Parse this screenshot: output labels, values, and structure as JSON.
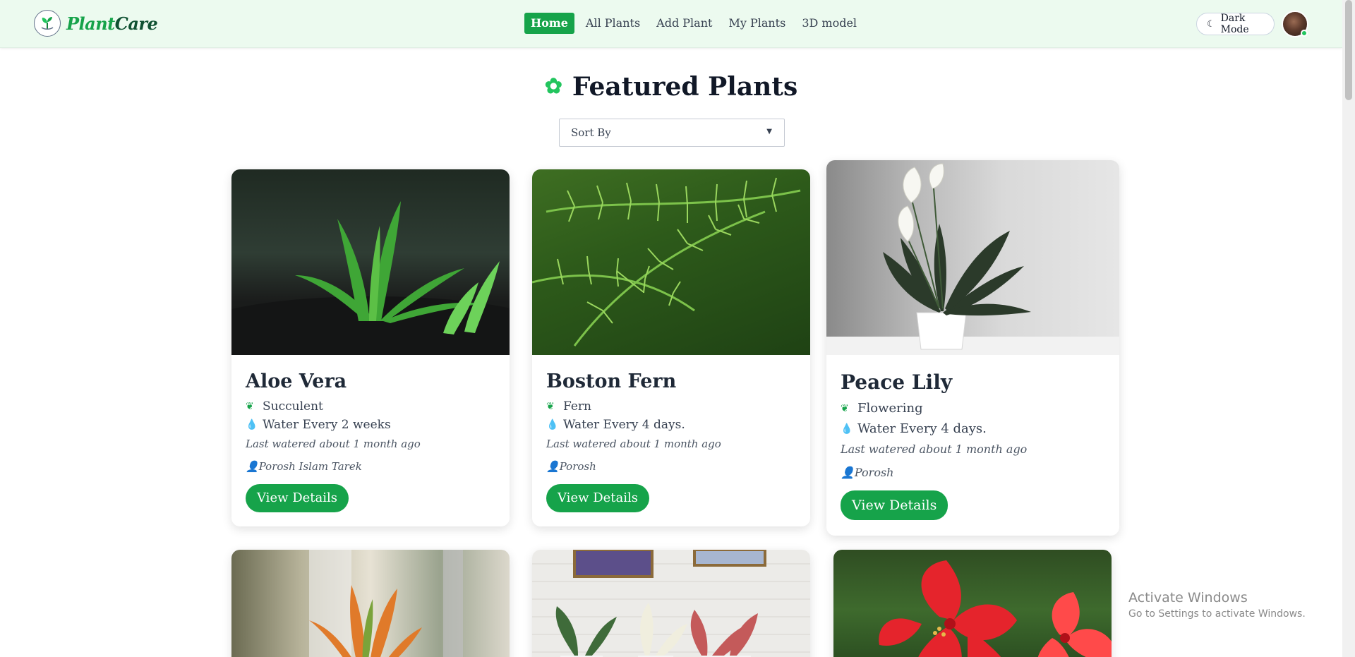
{
  "brand": {
    "name_part1": "Plant",
    "name_part2": "Care"
  },
  "nav": {
    "links": [
      "Home",
      "All Plants",
      "Add Plant",
      "My Plants",
      "3D model"
    ],
    "active": "Home"
  },
  "header": {
    "dark_mode_label": "Dark Mode"
  },
  "main": {
    "title": "Featured Plants",
    "sort_placeholder": "Sort By"
  },
  "cards": [
    {
      "name": "Aloe Vera",
      "category": "Succulent",
      "watering": "Water Every 2 weeks",
      "last_watered": "Last watered about 1 month ago",
      "author": "Porosh Islam Tarek",
      "button": "View Details"
    },
    {
      "name": "Boston Fern",
      "category": "Fern",
      "watering": "Water Every 4 days.",
      "last_watered": "Last watered about 1 month ago",
      "author": "Porosh",
      "button": "View Details"
    },
    {
      "name": "Peace Lily",
      "category": "Flowering",
      "watering": "Water Every 4 days.",
      "last_watered": "Last watered about 1 month ago",
      "author": "Porosh",
      "button": "View Details"
    }
  ],
  "watermark": {
    "line1": "Activate Windows",
    "line2": "Go to Settings to activate Windows."
  },
  "colors": {
    "accent": "#16a34a",
    "navbar_bg": "#ecfaef",
    "drop_icon": "#3b82f6"
  }
}
